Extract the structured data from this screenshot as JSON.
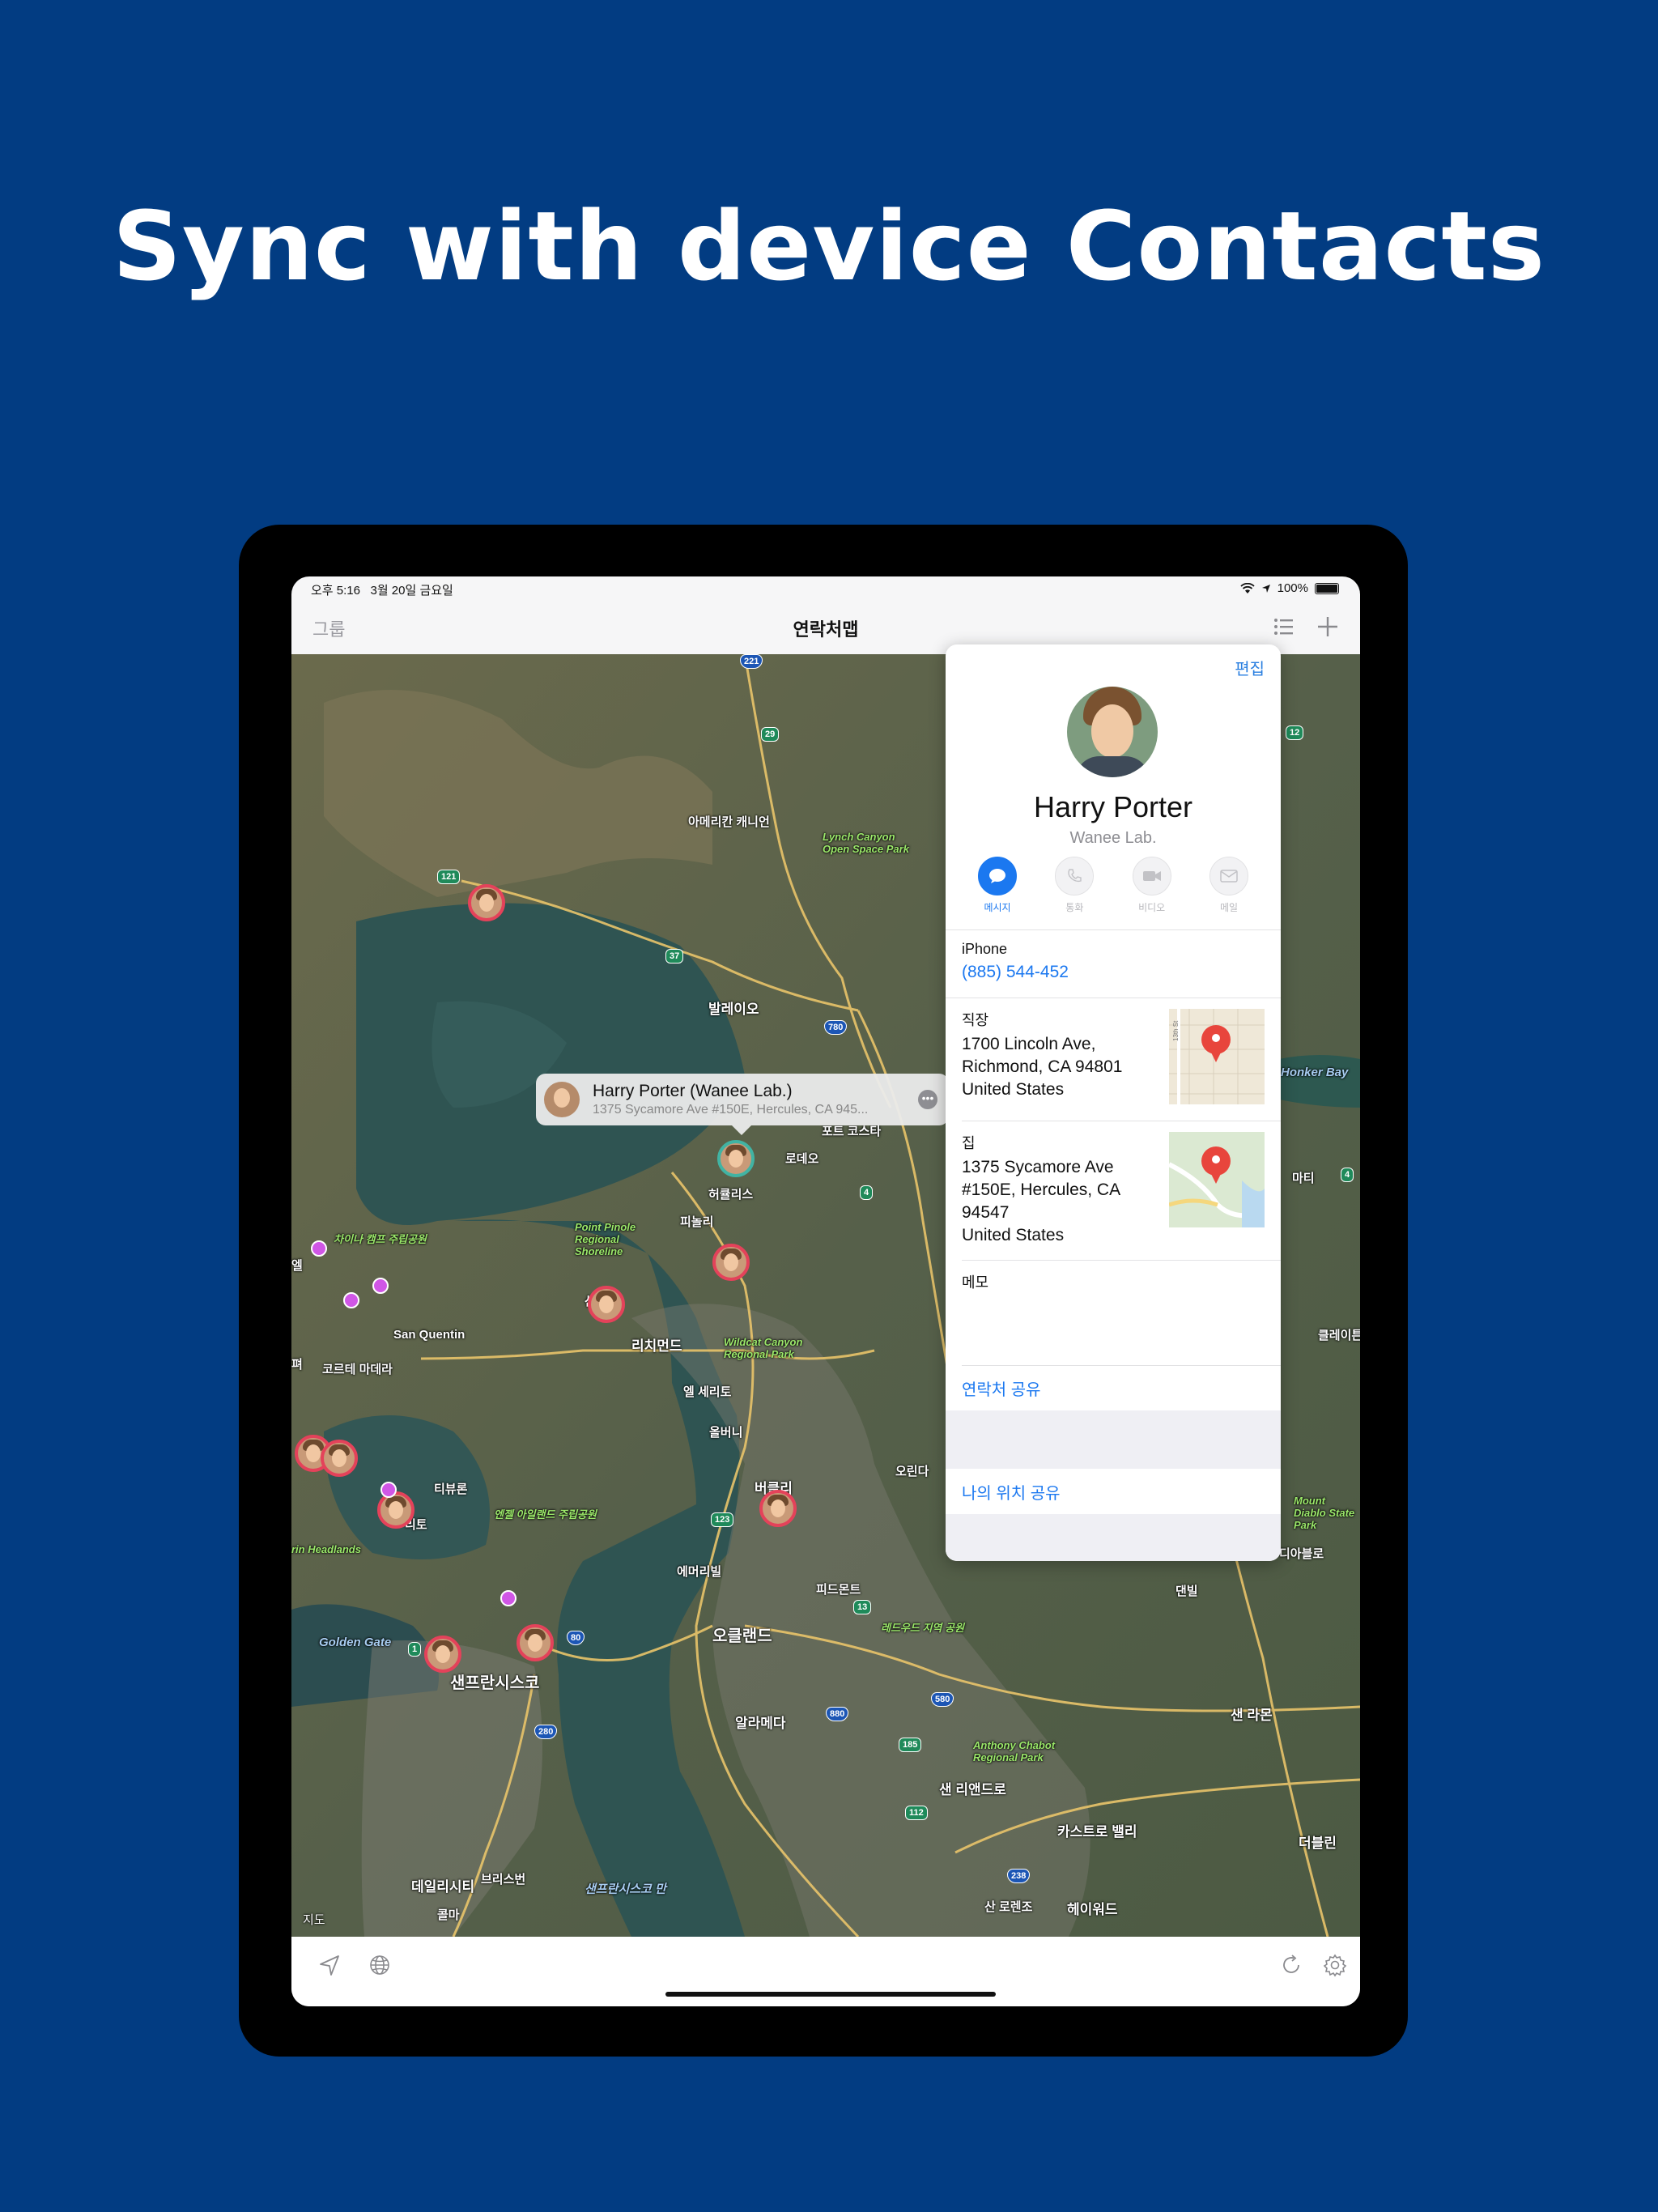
{
  "headline": "Sync with device Contacts",
  "status": {
    "time": "오후 5:16",
    "date": "3월 20일 금요일",
    "battery": "100%"
  },
  "navbar": {
    "left": "그룹",
    "title": "연락처맵"
  },
  "callout": {
    "title": "Harry Porter (Wanee Lab.)",
    "subtitle": "1375 Sycamore Ave #150E, Hercules, CA 945..."
  },
  "contact": {
    "edit": "편집",
    "name": "Harry Porter",
    "company": "Wanee Lab.",
    "actions": [
      {
        "label": "메시지",
        "icon": "message-icon",
        "active": true
      },
      {
        "label": "통화",
        "icon": "phone-icon",
        "active": false
      },
      {
        "label": "비디오",
        "icon": "video-icon",
        "active": false
      },
      {
        "label": "메일",
        "icon": "mail-icon",
        "active": false
      }
    ],
    "phone_label": "iPhone",
    "phone_value": "(885) 544-452",
    "work_label": "직장",
    "work_lines": [
      "1700 Lincoln Ave,",
      "Richmond, CA 94801",
      "United States"
    ],
    "work_map_street": "13th St",
    "home_label": "집",
    "home_lines": [
      "1375 Sycamore Ave",
      "#150E, Hercules, CA",
      "94547",
      "United States"
    ],
    "memo_label": "메모",
    "share_contact": "연락처 공유",
    "share_location": "나의 위치 공유"
  },
  "map": {
    "attribution": "지도",
    "labels": {
      "americancanyon": "아메리칸 캐니언",
      "lynchcanyon": "Lynch Canyon Open Space Park",
      "vallejo": "발레이오",
      "portcosta": "포트 코스타",
      "rodeo": "로데오",
      "hercules": "허큘리스",
      "pinole": "피놀리",
      "pinolepoint": "Point Pinole Regional Shoreline",
      "martinez": "마티",
      "honkerbay": "Honker Bay",
      "chinacamp": "차이나 캠프 주립공원",
      "sanquentin": "San Quentin",
      "richmond": "리치먼드",
      "wildcat": "Wildcat Canyon Regional Park",
      "clayton": "클레이튼",
      "cortemadera": "코르테 마데라",
      "elcerrito": "엘 세리토",
      "albany": "올버니",
      "berkeley": "버클리",
      "orinda": "오린다",
      "tiburon": "티뷰론",
      "angelisland": "엔젤 아일랜드 주립공원",
      "sausalito": "리토",
      "marinheadlands": "rin Headlands",
      "emeryville": "에머리빌",
      "piedmont": "피드몬트",
      "mountdiablo": "Mount Diablo State Park",
      "danville": "댄빌",
      "blackhawk": "디아블로",
      "goldengate": "Golden Gate",
      "sanfrancisco": "샌프란시스코",
      "oakland": "오클랜드",
      "redwood": "레드우드 지역 공원",
      "alameda": "알라메다",
      "sanramon": "샌 라몬",
      "anthonychabot": "Anthony Chabot Regional Park",
      "sanleandro": "샌 리앤드로",
      "castrovalley": "카스트로 밸리",
      "dublin": "더블린",
      "dalycity": "데일리시티",
      "brisbane": "브리스번",
      "sfbay": "샌프란시스코 만",
      "colma": "콜마",
      "sanlorenzo": "산 로렌조",
      "hayward": "헤이워드",
      "petaluma": "펴",
      "novato": "엘",
      "sanpablo": "산",
      "harrymapsan": "산"
    },
    "shields": [
      "221",
      "29",
      "12",
      "121",
      "37",
      "780",
      "4",
      "4",
      "123",
      "13",
      "80",
      "1",
      "880",
      "580",
      "280",
      "185",
      "112",
      "238"
    ]
  },
  "colors": {
    "background": "#023c82",
    "accent": "#1b78f0"
  }
}
